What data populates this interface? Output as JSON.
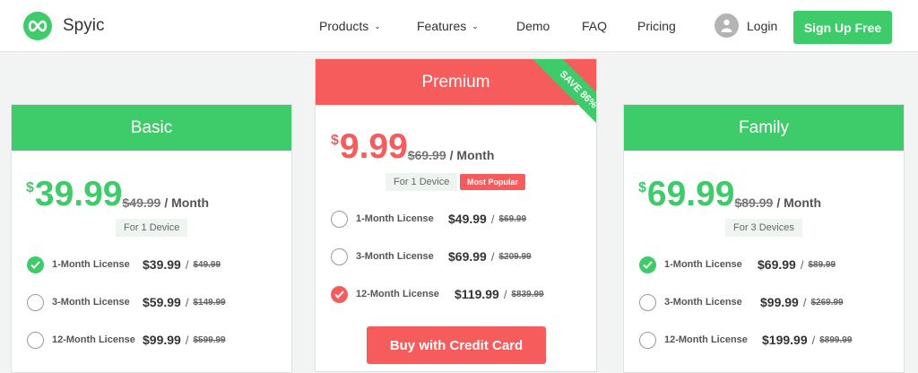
{
  "nav": {
    "brand": "Spyic",
    "items": [
      {
        "label": "Products",
        "dropdown": true
      },
      {
        "label": "Features",
        "dropdown": true
      },
      {
        "label": "Demo"
      },
      {
        "label": "FAQ"
      },
      {
        "label": "Pricing"
      }
    ],
    "login": "Login",
    "signup": "Sign Up Free"
  },
  "colors": {
    "green": "#3ecc6b",
    "red": "#f75c5c"
  },
  "plans": {
    "basic": {
      "name": "Basic",
      "currency": "$",
      "price": "39.99",
      "old_price": "$49.99",
      "period": "/ Month",
      "devices": "For 1 Device",
      "options": [
        {
          "label": "1-Month License",
          "price": "$39.99",
          "sep": "/",
          "was": "$49.99",
          "selected": true
        },
        {
          "label": "3-Month License",
          "price": "$59.99",
          "sep": "/",
          "was": "$149.99",
          "selected": false
        },
        {
          "label": "12-Month License",
          "price": "$99.99",
          "sep": "/",
          "was": "$599.99",
          "selected": false
        }
      ]
    },
    "premium": {
      "name": "Premium",
      "ribbon": "SAVE 86%",
      "currency": "$",
      "price": "9.99",
      "old_price": "$69.99",
      "period": "/ Month",
      "devices": "For 1 Device",
      "badge": "Most Popular",
      "options": [
        {
          "label": "1-Month License",
          "price": "$49.99",
          "sep": "/",
          "was": "$69.99",
          "selected": false
        },
        {
          "label": "3-Month License",
          "price": "$69.99",
          "sep": "/",
          "was": "$209.99",
          "selected": false
        },
        {
          "label": "12-Month License",
          "price": "$119.99",
          "sep": "/",
          "was": "$839.99",
          "selected": true
        }
      ],
      "buy": "Buy with Credit Card"
    },
    "family": {
      "name": "Family",
      "currency": "$",
      "price": "69.99",
      "old_price": "$89.99",
      "period": "/ Month",
      "devices": "For 3 Devices",
      "options": [
        {
          "label": "1-Month License",
          "price": "$69.99",
          "sep": "/",
          "was": "$89.99",
          "selected": true
        },
        {
          "label": "3-Month License",
          "price": "$99.99",
          "sep": "/",
          "was": "$269.99",
          "selected": false
        },
        {
          "label": "12-Month License",
          "price": "$199.99",
          "sep": "/",
          "was": "$899.99",
          "selected": false
        }
      ]
    }
  }
}
